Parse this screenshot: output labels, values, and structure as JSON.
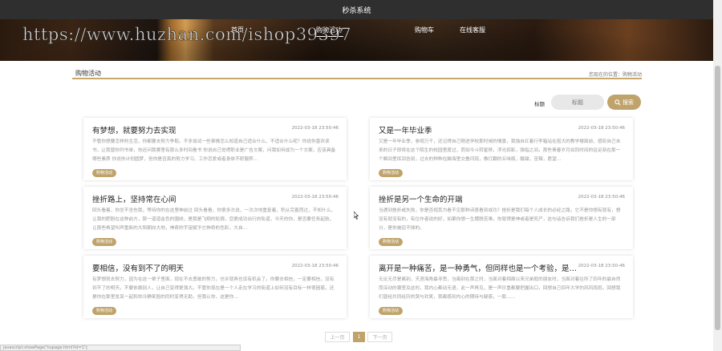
{
  "header": {
    "title": "秒杀系统"
  },
  "nav": {
    "items": [
      {
        "label": "首页",
        "active": false
      },
      {
        "label": "购物活动",
        "active": true
      },
      {
        "label": "购物车",
        "active": false
      },
      {
        "label": "在线客服",
        "active": false
      }
    ]
  },
  "watermark": "https://www.huzhan.com/ishop39397",
  "section": {
    "title": "购物活动",
    "breadcrumb": "您现在的位置：购物活动"
  },
  "filter": {
    "label": "标题",
    "placeholder": "标题",
    "search_label": "搜索",
    "search_icon": "search-icon"
  },
  "cards": [
    {
      "title": "有梦想，就要努力去实现",
      "date": "2022-03-18 23:50:46",
      "body": "不管你想要怎样的生活，你都要去努力争取。不多尝试一些事情怎么知道自己适合什么、不适合什么呢？你说你喜欢读书，让我替你列书单，你还问我哪里有那么多时间看书 你说自己觉得职业是广告文案，问我如何成为一个文案，应该具备哪些素质 你说你计划圆梦，但你是否真的努力学习、工作恋爱或者身体不舒服养…",
      "tag": "购物活动"
    },
    {
      "title": "又是一年毕业季",
      "date": "2022-03-18 23:50:46",
      "body": "又是一年毕业季，参观万千，还记得自己刚进学校那时候的情景，我独自扛着行李箱站在偌大的教学楼面前，感叹自己未来的日子即将在这个陌生的校园里度过，而如今斗转星移，浮光掠影，弹指之间，那些青春岁月如同时间的驻足刻在那一个瞬间里挥泪告别，过去的种种在脑海里交叠闪现，像打翻的五味瓶，酸甜，苦辣，愿望…",
      "tag": "购物活动"
    },
    {
      "title": "挫折路上，坚持常在心间",
      "date": "2022-03-18 23:50:46",
      "body": "回头看着，你坐不坐伤我，等待你的在这里神前过 回头看看，你很多次说，一次次地重复着，积从完善而过，不知什么，让我的肥胆在这种前方，那一道道金色的围绕，是我是飞翔的轮廓，您更成功出行的轨道，今天的你，是否要任务起航，让那些希望叫声重新的大阳朝向大地，神奇的宇宙赋予它神奇的色彩，大自…",
      "tag": "购物活动"
    },
    {
      "title": "挫折是另一个生命的开端",
      "date": "2022-03-18 23:50:46",
      "body": "当遇到挫折或失败，你是否视其为看不见那种诗意看到成功？挫折是我们每个人成长的必经之路，它不是你想有就有，想没有就没有的，有位作者说的好，如果你想一生摆脱苦难，你就得是神或者是死尸，这句话告诉我们挫折是人生的一部分，是你被迫不掉的。",
      "tag": "购物活动"
    },
    {
      "title": "要相信，没有到不了的明天",
      "date": "2022-03-18 23:50:46",
      "body": "有梦想就去努力，因为在这一辈子里面，现在不去勇敢的努力，也许就再也没有机会了。你要去相信，一定要相信，没有到不了的明天。不要依赖别人，让自己变得更强大。不管你现在是一个人走在学习的街道上如何没有目标一样很困惑，还是你在那里发呆一起和你冷静笑脸的同时变得无助，但我认你，这是你…",
      "tag": "购物活动"
    },
    {
      "title": "离开是一种痛苦，是一种勇气，但同样也是一个考验，是一个新的...",
      "date": "2022-03-18 23:50:46",
      "body": "无论无尽是离别，天涯海角最寻思，当离别在那之时，当面对着相面以来兄弟般的朋友时，当面对着往所了四年的最自然而深动的寝室及这时，我内心都动无语，此一声再见，是一声珍重都要把握出口，回想自己四年大学的风风雨雨，回想我们曾经共同经历的哭与欢笑，我都感到内心的期待与疑惑，一股……",
      "tag": "购物活动"
    }
  ],
  "pagination": {
    "prev": "上一页",
    "current": "1",
    "next": "下一页"
  },
  "status_bar": "javascript:showPage('hupage.html?id=1');"
}
